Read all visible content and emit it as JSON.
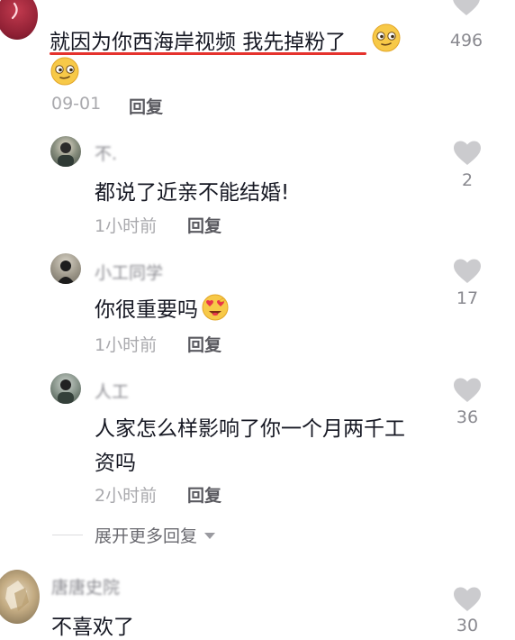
{
  "colors": {
    "heart": "#cbcbce",
    "underline": "#e5322d",
    "emoji_face": "#f7c948"
  },
  "top_comment": {
    "text": "就因为你西海岸视频 我先掉粉了",
    "date": "09-01",
    "reply_label": "回复",
    "likes": "496"
  },
  "replies": [
    {
      "username": "不.",
      "text": "都说了近亲不能结婚!",
      "time": "1小时前",
      "reply_label": "回复",
      "likes": "2"
    },
    {
      "username": "小工同学",
      "text": "你很重要吗",
      "time": "1小时前",
      "reply_label": "回复",
      "likes": "17"
    },
    {
      "username": "人工",
      "text_line1": "人家怎么样影响了你一个月两千工",
      "text_line2": "资吗",
      "time": "2小时前",
      "reply_label": "回复",
      "likes": "36"
    }
  ],
  "expand_label": "展开更多回复",
  "next_comment": {
    "username": "唐唐史院",
    "text": "不喜欢了",
    "likes": "30"
  }
}
